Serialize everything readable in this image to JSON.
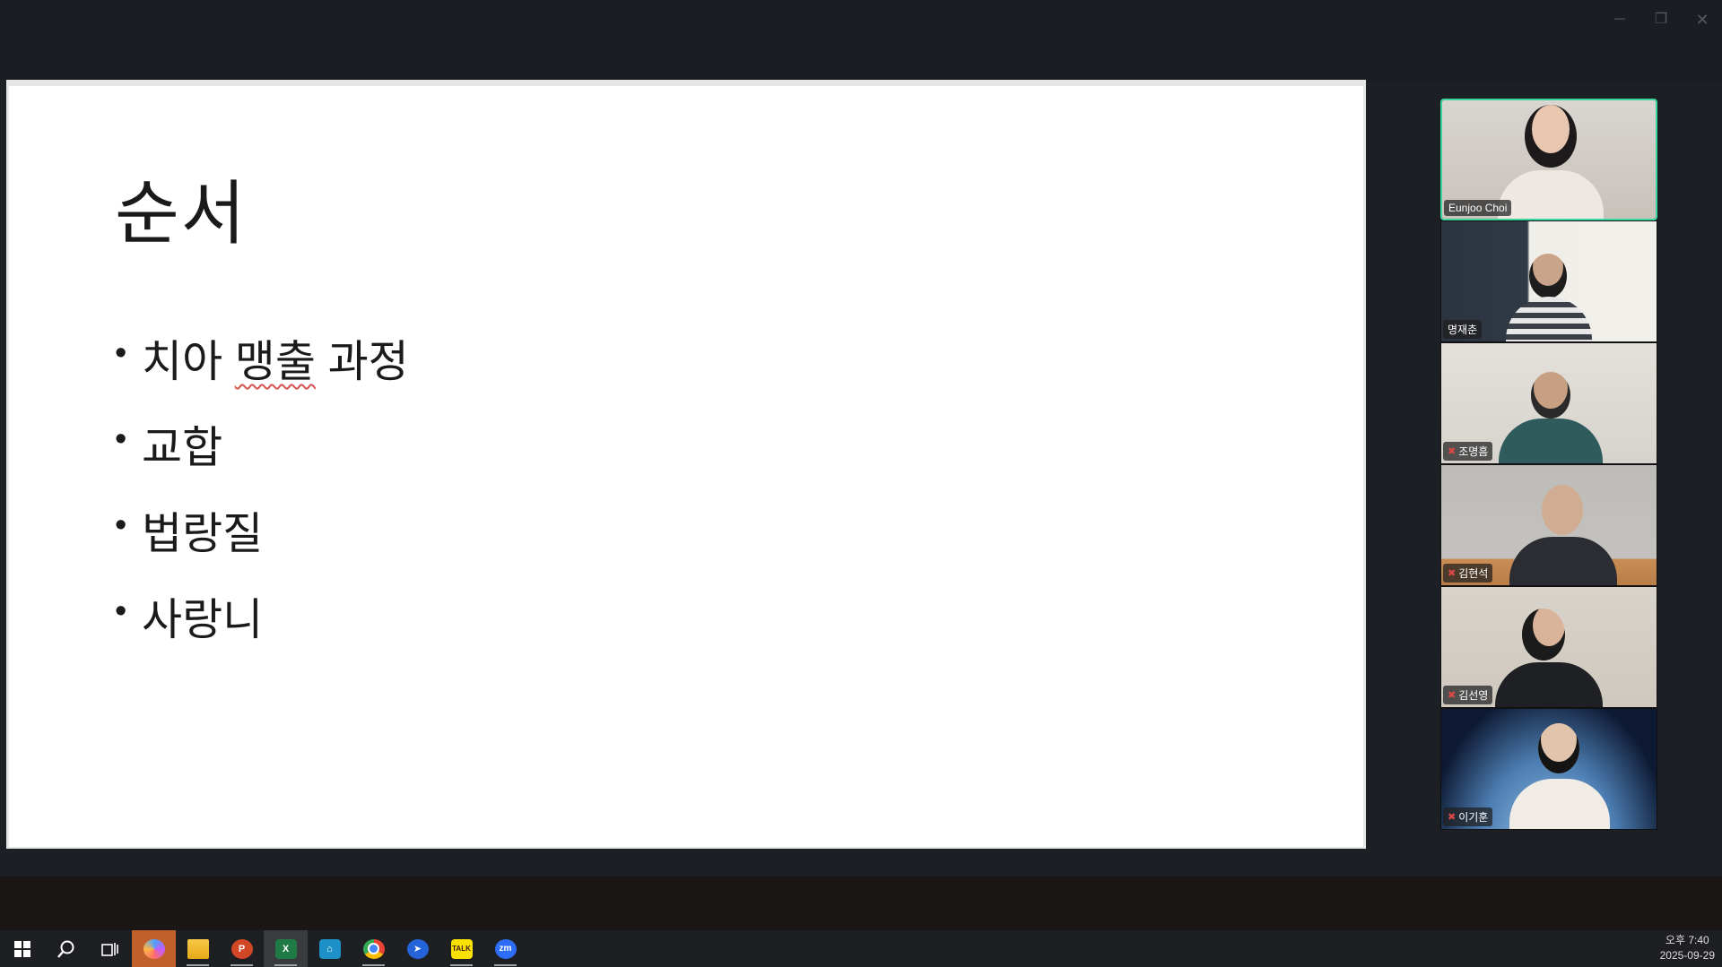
{
  "window": {
    "minimize_glyph": "─",
    "maximize_glyph": "❐",
    "close_glyph": "✕"
  },
  "slide": {
    "title": "순서",
    "bullets": [
      {
        "text": "치아 ",
        "flagged": "맹출",
        "rest": " 과정"
      },
      {
        "text": "교합"
      },
      {
        "text": "법랑질"
      },
      {
        "text": "사랑니"
      }
    ]
  },
  "participants": [
    {
      "name": "Eunjoo Choi",
      "muted": false,
      "active": true
    },
    {
      "name": "명재춘",
      "muted": false,
      "active": false
    },
    {
      "name": "조명흠",
      "muted": true,
      "active": false
    },
    {
      "name": "김현석",
      "muted": true,
      "active": false
    },
    {
      "name": "김선영",
      "muted": true,
      "active": false
    },
    {
      "name": "이기훈",
      "muted": true,
      "active": false
    }
  ],
  "mute_icon": "mic-muted-icon",
  "taskbar": {
    "apps": [
      {
        "id": "start",
        "icon": "windows-start-icon"
      },
      {
        "id": "search",
        "icon": "search-icon"
      },
      {
        "id": "taskview",
        "icon": "task-view-icon"
      },
      {
        "id": "copilot",
        "icon": "copilot-icon"
      },
      {
        "id": "explorer",
        "icon": "folder-icon"
      },
      {
        "id": "powerpoint",
        "icon": "powerpoint-icon",
        "label": "P"
      },
      {
        "id": "excel",
        "icon": "excel-icon",
        "label": "X"
      },
      {
        "id": "app",
        "icon": "app-icon"
      },
      {
        "id": "chrome",
        "icon": "chrome-icon"
      },
      {
        "id": "pin",
        "icon": "pin-app-icon"
      },
      {
        "id": "kakaotalk",
        "icon": "kakaotalk-icon",
        "label": "TALK"
      },
      {
        "id": "zoom",
        "icon": "zoom-icon",
        "label": "zm"
      }
    ],
    "clock": {
      "time": "오후 7:40",
      "date": "2025-09-29"
    }
  },
  "colors": {
    "active_speaker_border": "#39d6a0",
    "muted_icon": "#e04848",
    "taskbar_bg": "#1e1f22"
  }
}
